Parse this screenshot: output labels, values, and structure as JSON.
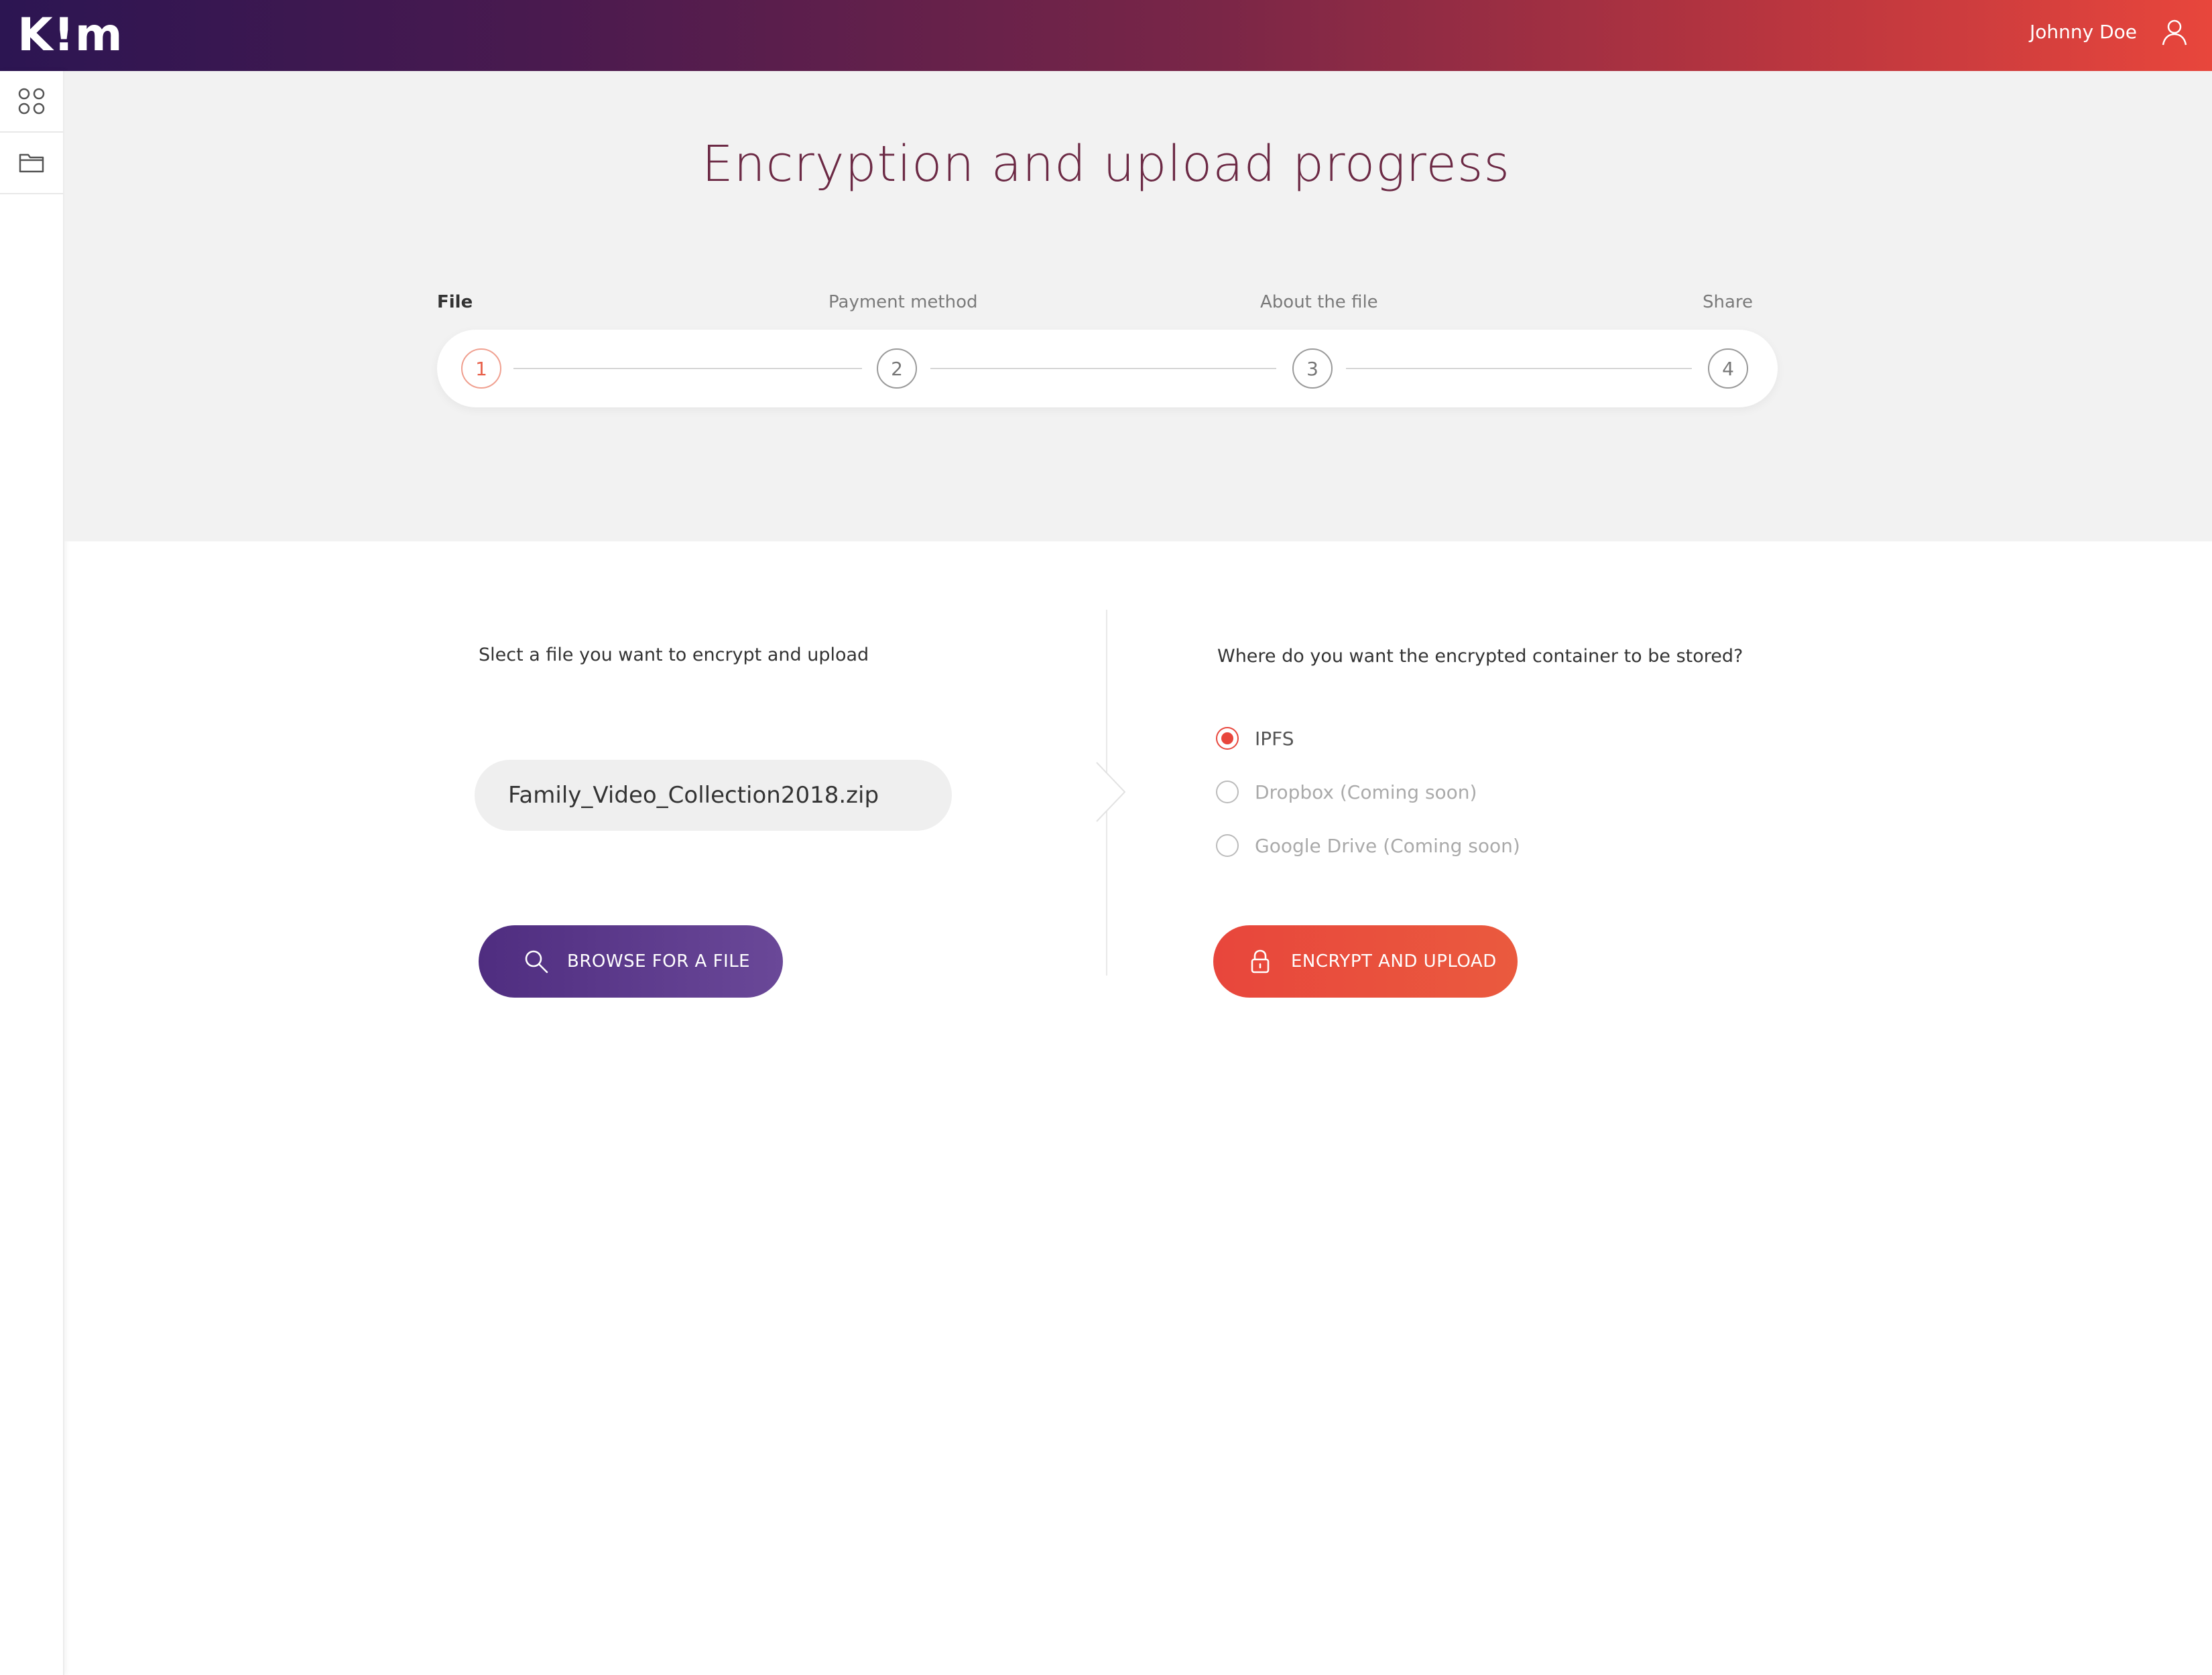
{
  "header": {
    "logo_text": "K!m",
    "user_name": "Johnny Doe"
  },
  "sidebar": {
    "items": [
      {
        "icon": "apps-grid-icon"
      },
      {
        "icon": "folder-icon"
      }
    ]
  },
  "main": {
    "title": "Encryption and upload progress",
    "steps": [
      {
        "label": "File",
        "number": "1",
        "active": true
      },
      {
        "label": "Payment method",
        "number": "2",
        "active": false
      },
      {
        "label": "About the file",
        "number": "3",
        "active": false
      },
      {
        "label": "Share",
        "number": "4",
        "active": false
      }
    ]
  },
  "file_panel": {
    "prompt": "Slect a file you want to encrypt and upload",
    "file_value": "Family_Video_Collection2018.zip",
    "browse_label": "BROWSE FOR A FILE",
    "browse_icon": "search-icon"
  },
  "storage_panel": {
    "prompt": "Where do you want the encrypted container to be stored?",
    "options": [
      {
        "label": "IPFS",
        "selected": true,
        "disabled": false
      },
      {
        "label": "Dropbox (Coming soon)",
        "selected": false,
        "disabled": true
      },
      {
        "label": "Google Drive (Coming soon)",
        "selected": false,
        "disabled": true
      }
    ],
    "submit_label": "ENCRYPT AND UPLOAD",
    "submit_icon": "lock-icon"
  },
  "colors": {
    "accent": "#e8463c",
    "brand_purple": "#4f2d80",
    "title": "#6c2a45"
  }
}
